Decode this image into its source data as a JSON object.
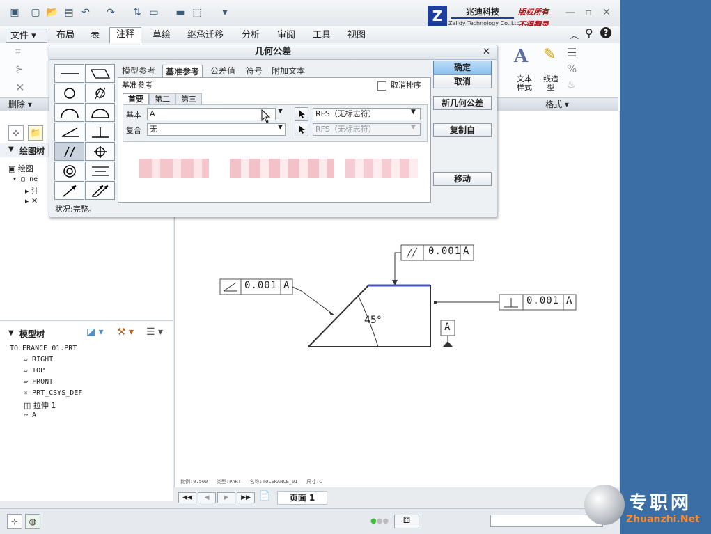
{
  "menu": {
    "file": "文件",
    "tabs": [
      "布局",
      "表",
      "注释",
      "草绘",
      "继承迁移",
      "分析",
      "审阅",
      "工具",
      "视图"
    ],
    "active_tab": "注释"
  },
  "brand": {
    "company": "兆迪科技",
    "company_en": "Zalidy Technology Co.,Ltd.",
    "rights1": "版权所有",
    "rights2": "不得翻录"
  },
  "ribbon": {
    "delete_label": "删除",
    "text_style": "文本\n样式",
    "line_style": "线造\n型",
    "format_label": "格式"
  },
  "left": {
    "drawing_tree": "绘图树",
    "drawing_item": "绘图",
    "tree_ne": "ne",
    "tree_note": "注",
    "model_tree": "模型树",
    "model_items": [
      "TOLERANCE_01.PRT",
      "RIGHT",
      "TOP",
      "FRONT",
      "PRT_CSYS_DEF",
      "拉伸 1",
      "A"
    ]
  },
  "dialog": {
    "title": "几何公差",
    "tabs": [
      "模型参考",
      "基准参考",
      "公差值",
      "符号",
      "附加文本"
    ],
    "active_tab": "基准参考",
    "section_label": "基准参考",
    "unsort": "取消排序",
    "subtabs": [
      "首要",
      "第二",
      "第三"
    ],
    "basic_label": "基本",
    "basic_value": "A",
    "composite_label": "复合",
    "composite_value": "无",
    "rfs1": "RFS（无标志符）",
    "rfs2": "RFS（无标志符）",
    "status": "状况:完整。",
    "buttons": {
      "ok": "确定",
      "cancel": "取消",
      "new": "新几何公差",
      "copy": "复制自",
      "move": "移动"
    }
  },
  "drawing": {
    "fcf_top": "0.001",
    "fcf_top_datum": "A",
    "fcf_left": "0.001",
    "fcf_left_datum": "A",
    "fcf_right": "0.001",
    "fcf_right_datum": "A",
    "datum_label": "A",
    "angle": "45°",
    "footer": "比例:0.500   类型:PART   名称:TOLERANCE_01   尺寸:C"
  },
  "pager": {
    "page_label": "页面 1"
  },
  "watermark": {
    "cn": "专职网",
    "en": "Zhuanzhi.Net"
  }
}
